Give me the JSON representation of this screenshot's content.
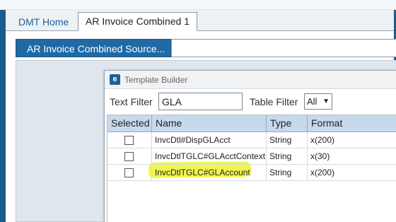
{
  "tabs": {
    "home": "DMT Home",
    "active": "AR Invoice Combined 1"
  },
  "source_button": "AR Invoice Combined Source...",
  "dialog": {
    "title": "Template Builder",
    "text_filter_label": "Text Filter",
    "text_filter_value": "GLA",
    "table_filter_label": "Table Filter",
    "table_filter_value": "All",
    "columns": [
      "Selected",
      "Name",
      "Type",
      "Format"
    ],
    "rows": [
      {
        "name": "InvcDtl#DispGLAcct",
        "type": "String",
        "format": "x(200)"
      },
      {
        "name": "InvcDtlTGLC#GLAcctContext",
        "type": "String",
        "format": "x(30)"
      },
      {
        "name": "InvcDtlTGLC#GLAccount",
        "type": "String",
        "format": "x(200)"
      }
    ]
  },
  "colors": {
    "accent": "#1f6aa5",
    "header_bg": "#c7d9ec",
    "highlight": "#f0f53a"
  }
}
